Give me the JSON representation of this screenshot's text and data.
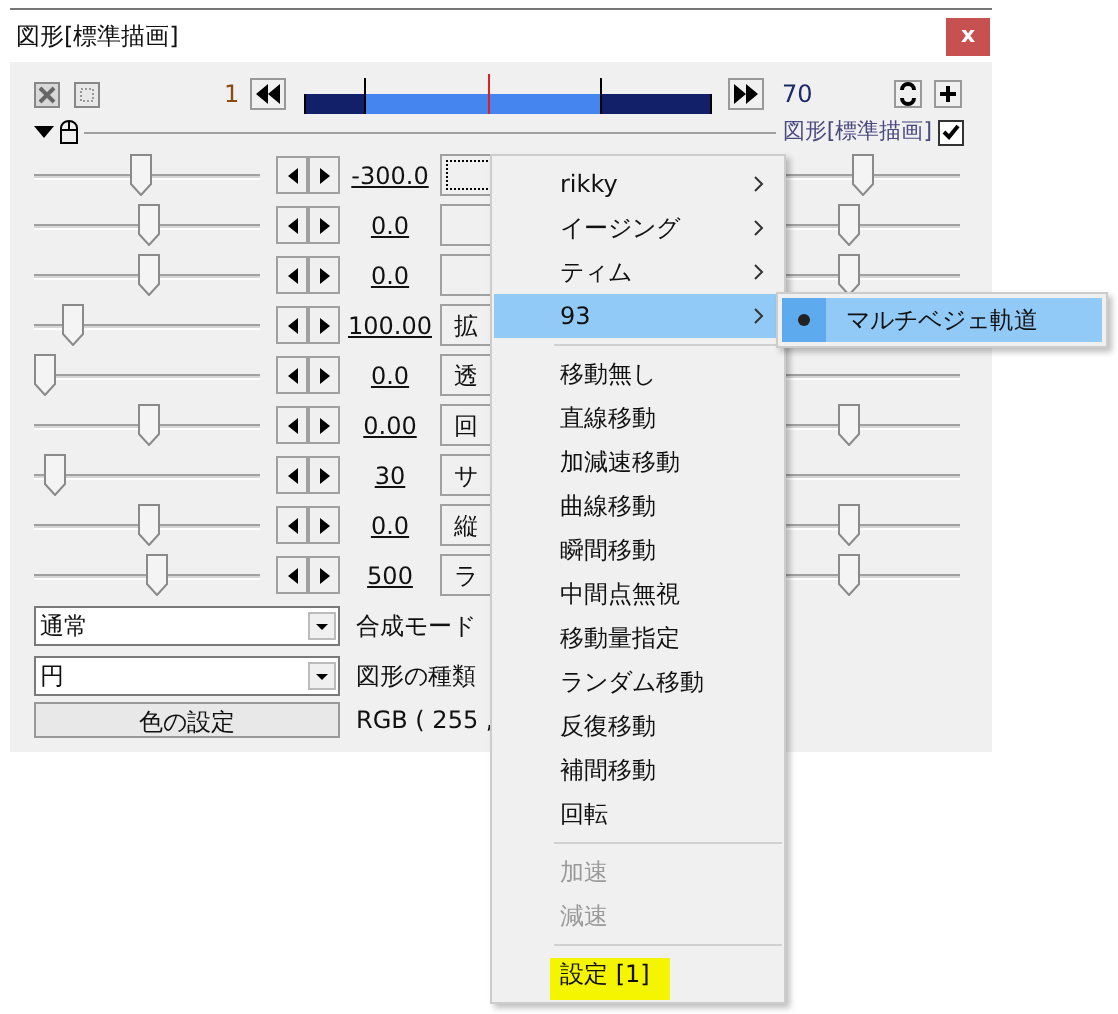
{
  "window": {
    "title": "図形[標準描画]",
    "close": "x"
  },
  "toolbar": {
    "start_frame": "1",
    "end_frame": "70",
    "timeline": {
      "level": 0.45
    }
  },
  "object_header": {
    "expanded": true,
    "label": "図形[標準描画]",
    "checked": true
  },
  "tracks": [
    {
      "value": "-300.0",
      "focused": true,
      "level": 0.47,
      "end": {
        "level": 0.73
      }
    },
    {
      "value": "0.0",
      "focused": false,
      "level": 0.5,
      "end": {
        "level": 0.69
      }
    },
    {
      "value": "0.0",
      "focused": false,
      "level": 0.5,
      "end": {
        "level": 0.69
      }
    },
    {
      "value": "100.00",
      "button": "拡",
      "focused": false,
      "level": 0.17
    },
    {
      "value": "0.0",
      "button": "透",
      "focused": false,
      "level": 0.04
    },
    {
      "value": "0.00",
      "button": "回",
      "focused": false,
      "level": 0.5,
      "end": {
        "level": 0.69
      }
    },
    {
      "value": "30",
      "button": "サ",
      "focused": false,
      "level": 0.09
    },
    {
      "value": "0.0",
      "button": "縦",
      "focused": false,
      "level": 0.5,
      "end": {
        "level": 0.69
      }
    },
    {
      "value": "500",
      "button": "ラ",
      "focused": false,
      "level": 0.54,
      "end": {
        "level": 0.69
      }
    }
  ],
  "blend_mode": {
    "value": "通常",
    "label": "合成モード"
  },
  "shape_type": {
    "value": "円",
    "label": "図形の種類"
  },
  "color": {
    "button": "色の設定",
    "value": "RGB ( 255 ,"
  },
  "context_menu": {
    "items": [
      {
        "kind": "submenu",
        "label": "rikky",
        "selected": false,
        "disabled": false,
        "marked": false
      },
      {
        "kind": "submenu",
        "label": "イージング",
        "selected": false,
        "disabled": false,
        "marked": false
      },
      {
        "kind": "submenu",
        "label": "ティム",
        "selected": false,
        "disabled": false,
        "marked": false
      },
      {
        "kind": "submenu",
        "label": "93",
        "selected": true,
        "disabled": false,
        "marked": false
      },
      {
        "kind": "separator"
      },
      {
        "kind": "item",
        "label": "移動無し",
        "selected": false,
        "disabled": false,
        "marked": false
      },
      {
        "kind": "item",
        "label": "直線移動",
        "selected": false,
        "disabled": false,
        "marked": false
      },
      {
        "kind": "item",
        "label": "加減速移動",
        "selected": false,
        "disabled": false,
        "marked": false
      },
      {
        "kind": "item",
        "label": "曲線移動",
        "selected": false,
        "disabled": false,
        "marked": false
      },
      {
        "kind": "item",
        "label": "瞬間移動",
        "selected": false,
        "disabled": false,
        "marked": false
      },
      {
        "kind": "item",
        "label": "中間点無視",
        "selected": false,
        "disabled": false,
        "marked": false
      },
      {
        "kind": "item",
        "label": "移動量指定",
        "selected": false,
        "disabled": false,
        "marked": false
      },
      {
        "kind": "item",
        "label": "ランダム移動",
        "selected": false,
        "disabled": false,
        "marked": false
      },
      {
        "kind": "item",
        "label": "反復移動",
        "selected": false,
        "disabled": false,
        "marked": false
      },
      {
        "kind": "item",
        "label": "補間移動",
        "selected": false,
        "disabled": false,
        "marked": false
      },
      {
        "kind": "item",
        "label": "回転",
        "selected": false,
        "disabled": false,
        "marked": false
      },
      {
        "kind": "separator"
      },
      {
        "kind": "item",
        "label": "加速",
        "selected": false,
        "disabled": true,
        "marked": false
      },
      {
        "kind": "item",
        "label": "減速",
        "selected": false,
        "disabled": true,
        "marked": false
      },
      {
        "kind": "separator"
      },
      {
        "kind": "item",
        "label": "設定 [1]",
        "selected": false,
        "disabled": false,
        "marked": true
      }
    ]
  },
  "submenu": {
    "items": [
      {
        "label": "マルチベジェ軌道",
        "checked": true,
        "selected": true
      }
    ]
  }
}
